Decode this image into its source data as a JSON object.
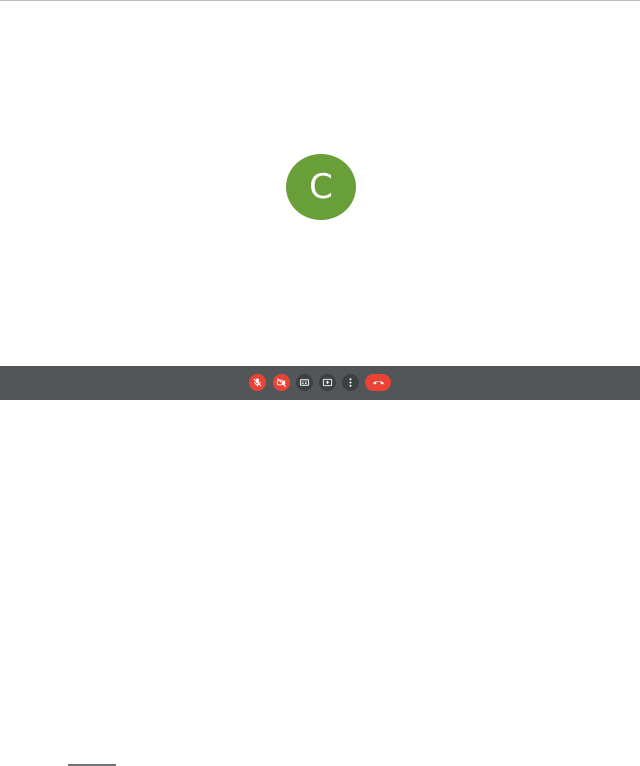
{
  "participant": {
    "avatar_initial": "C",
    "avatar_color": "#689f38"
  },
  "controls": [
    {
      "id": "mic",
      "icon": "mic-off-icon",
      "state": "off",
      "color": "#ea4335"
    },
    {
      "id": "camera",
      "icon": "videocam-off-icon",
      "state": "off",
      "color": "#ea4335"
    },
    {
      "id": "captions",
      "icon": "closed-caption-icon",
      "state": "off",
      "color": "#3c4043"
    },
    {
      "id": "present",
      "icon": "present-screen-icon",
      "color": "#3c4043"
    },
    {
      "id": "more",
      "icon": "more-vert-icon",
      "color": "#3c4043"
    },
    {
      "id": "hangup",
      "icon": "call-end-icon",
      "color": "#ea4335"
    }
  ],
  "colors": {
    "control_bar": "#525659",
    "stage_background": "#ffffff"
  }
}
